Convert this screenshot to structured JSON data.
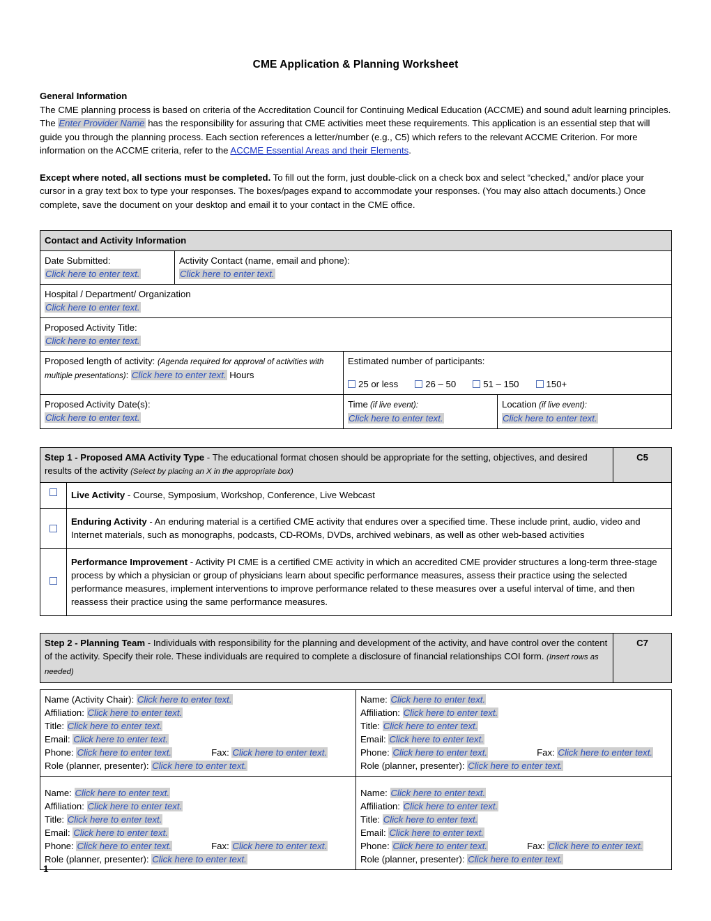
{
  "document": {
    "title": "CME Application & Planning Worksheet",
    "page_number": "1"
  },
  "general_information": {
    "heading": "General Information",
    "paragraph1_part1": "The CME planning process is based on criteria of the Accreditation Council for Continuing Medical Education (ACCME) and sound adult learning principles.  The ",
    "provider_placeholder": "Enter Provider Name",
    "paragraph1_part2": " has the responsibility for assuring that CME activities meet these requirements.  This application is an essential step that will guide you through the planning process.  Each section references a letter/number (e.g., C5) which refers to the relevant ACCME Criterion.  For more information on the ACCME criteria, refer to the ",
    "link_text": "ACCME Essential Areas and their Elements",
    "paragraph1_part3": ".",
    "paragraph2_bold": "Except where noted, all sections must be completed.",
    "paragraph2_rest": " To fill out the form, just double-click on a check box and select “checked,” and/or place your cursor in a gray text box to type your responses. The boxes/pages expand to accommodate your responses. (You may also attach documents.)  Once complete, save the document on your desktop and email it to your contact in the CME office."
  },
  "placeholder": "Click here to enter text.",
  "contact_table": {
    "header": "Contact and Activity Information",
    "date_submitted_label": "Date Submitted:",
    "date_submitted_value": "Click here to enter text.",
    "activity_contact_label": "Activity Contact (name, email and phone):",
    "activity_contact_value": "Click here to enter text.",
    "organization_label": "Hospital / Department/ Organization",
    "organization_value": "Click here to enter text.",
    "activity_title_label": "Proposed Activity Title:",
    "activity_title_value": "Click here to enter text.",
    "length_label": "Proposed length of activity:",
    "length_italic": "(Agenda required for approval of activities with multiple presentations)",
    "length_colon": ":",
    "length_value": "Click here to enter text.",
    "length_unit": " Hours",
    "participants_label": "Estimated number of participants:",
    "participants_options": [
      "25 or less",
      "26 – 50",
      "51 – 150",
      "150+"
    ],
    "dates_label": "Proposed Activity Date(s):",
    "dates_value": "Click here to enter text.",
    "time_label": "Time",
    "time_label_italic": " (if live event):",
    "time_value": "Click here to enter text.",
    "location_label": "Location",
    "location_label_italic": " (if live event):",
    "location_value": "Click here to enter text."
  },
  "step1": {
    "title": "Step 1 - Proposed AMA Activity Type",
    "desc_part1": "  - The educational format chosen should be appropriate for the setting, objectives, and desired results of the activity ",
    "desc_italic": "(Select by placing an X in the appropriate box)",
    "criterion": "C5",
    "options": [
      {
        "bold": "Live Activity",
        "rest": " - Course, Symposium, Workshop, Conference, Live Webcast"
      },
      {
        "bold": "Enduring Activity",
        "rest": " - An enduring material is a certified CME activity that endures over a specified time. These include print, audio, video and Internet materials, such as monographs, podcasts, CD-ROMs, DVDs, archived webinars, as well as other web-based activities"
      },
      {
        "bold": "Performance Improvement",
        "rest": " - Activity PI CME is a certified CME activity in which an accredited CME provider structures a long-term three-stage process by which a physician or group of physicians learn about specific performance measures, assess their practice using the selected performance measures, implement interventions to improve performance related to these measures over a useful interval of time, and then reassess their practice using the same performance measures."
      }
    ]
  },
  "step2": {
    "title": "Step 2 - Planning Team",
    "desc": " - Individuals with responsibility for the planning and development of the activity, and have control over the content of the activity.  Specify their role.  These individuals are required to complete a disclosure of financial relationships COI form.  ",
    "desc_italic": "(Insert rows as needed)",
    "criterion": "C7",
    "labels": {
      "name_chair": "Name (Activity Chair):",
      "name": "Name:",
      "affiliation": "Affiliation:",
      "title": "Title:",
      "email": "Email:",
      "phone": "Phone:",
      "fax": "Fax:",
      "role": "Role (planner, presenter):"
    },
    "people": [
      {
        "name_label": "Name (Activity Chair):",
        "name_value": "Click here to enter text.",
        "affiliation_value": "Click here to enter text.",
        "title_value": "Click here to enter text.",
        "email_value": "Click here to enter text.",
        "phone_value": "Click here to enter text.",
        "fax_value": "Click here to enter text.",
        "role_value": "Click here to enter text."
      },
      {
        "name_label": "Name:",
        "name_value": "Click here to enter text.",
        "affiliation_value": "Click here to enter text.",
        "title_value": "Click here to enter text.",
        "email_value": "Click here to enter text.",
        "phone_value": "Click here to enter text.",
        "fax_value": "Click here to enter text.",
        "role_value": "Click here to enter text."
      },
      {
        "name_label": "Name:",
        "name_value": "Click here to enter text.",
        "affiliation_value": "Click here to enter text.",
        "title_value": "Click here to enter text.",
        "email_value": "Click here to enter text.",
        "phone_value": "Click here to enter text.",
        "fax_value": "Click here to enter text.",
        "role_value": "Click here to enter text."
      },
      {
        "name_label": "Name:",
        "name_value": "Click here to enter text.",
        "affiliation_value": "Click here to enter text.",
        "title_value": "Click here to enter text.",
        "email_value": "Click here to enter text.",
        "phone_value": "Click here to enter text.",
        "fax_value": "Click here to enter text.",
        "role_value": "Click here to enter text."
      }
    ]
  },
  "colors": {
    "field_text": "#2a4fbd",
    "field_highlight": "#cfcfcf",
    "link": "#1b36c4",
    "table_shade": "#d9d9d9",
    "checkbox_border": "#4a6ab5"
  }
}
